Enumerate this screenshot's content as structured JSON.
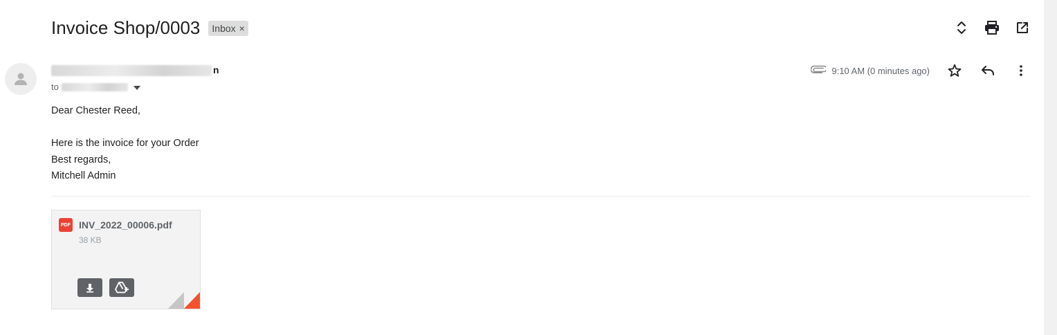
{
  "subject": {
    "title": "Invoice Shop/0003",
    "label": "Inbox",
    "label_remove": "×"
  },
  "top_actions": {
    "icons": [
      "expand-collapse-icon",
      "print-icon",
      "open-in-new-window-icon"
    ]
  },
  "message": {
    "sender_visible_tail": "n",
    "to_prefix": "to",
    "time": "9:10 AM (0 minutes ago)",
    "body": {
      "greeting": "Dear Chester Reed,",
      "line1": "Here is the invoice for your Order",
      "line2": "Best regards,",
      "line3": "Mitchell Admin"
    }
  },
  "attachment": {
    "type_badge": "PDF",
    "filename": "INV_2022_00006.pdf",
    "size": "38 KB"
  },
  "colors": {
    "pdf_red": "#ea4335",
    "chip_bg": "#dddddd",
    "icon_dark": "#5f6368"
  }
}
